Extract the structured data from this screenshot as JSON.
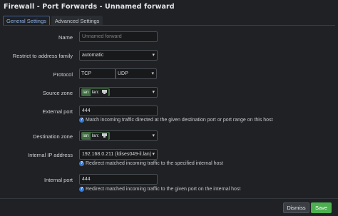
{
  "title": "Firewall - Port Forwards - Unnamed forward",
  "tabs": [
    "General Settings",
    "Advanced Settings"
  ],
  "form": {
    "name": {
      "label": "Name",
      "placeholder": "Unnamed forward"
    },
    "family": {
      "label": "Restrict to address family",
      "value": "automatic"
    },
    "protocol": {
      "label": "Protocol",
      "options": [
        "TCP",
        "UDP"
      ]
    },
    "source_zone": {
      "label": "Source zone",
      "zone": "lan",
      "iface_label": "lan:"
    },
    "external_port": {
      "label": "External port",
      "value": "444",
      "help": "Match incoming traffic directed at the given destination port or port range on this host"
    },
    "dest_zone": {
      "label": "Destination zone",
      "zone": "lan",
      "iface_label": "lan:"
    },
    "internal_ip": {
      "label": "Internal IP address",
      "value": "192.168.0.211 (ldises049-il.lan)",
      "help": "Redirect matched incoming traffic to the specified internal host"
    },
    "internal_port": {
      "label": "Internal port",
      "value": "444",
      "help": "Redirect matched incoming traffic to the given port on the internal host"
    }
  },
  "buttons": {
    "dismiss": "Dismiss",
    "save": "Save"
  },
  "colors": {
    "background": "#1f2124",
    "accent": "#3a7bd5",
    "zone": "#3e6b3f",
    "save": "#4caf50"
  }
}
